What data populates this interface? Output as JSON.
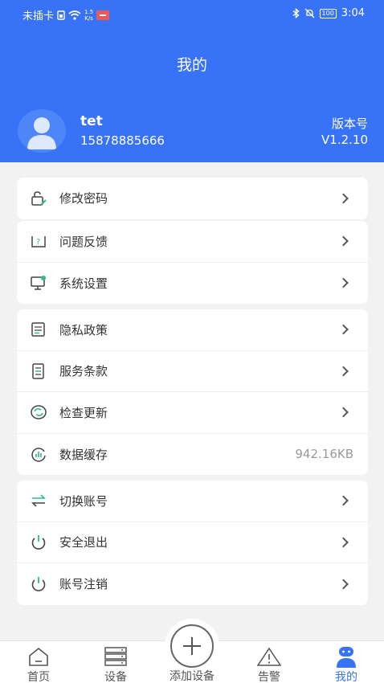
{
  "status_bar": {
    "carrier": "未插卡",
    "speed_value": "1.5",
    "speed_unit": "K/s",
    "battery": "100",
    "time": "3:04"
  },
  "header": {
    "title": "我的"
  },
  "profile": {
    "username": "tet",
    "phone": "15878885666",
    "version_label": "版本号",
    "version_value": "V1.2.10"
  },
  "menu_groups": [
    [
      {
        "label": "修改密码",
        "icon": "lock-edit-icon"
      }
    ],
    [
      {
        "label": "问题反馈",
        "icon": "feedback-icon"
      },
      {
        "label": "系统设置",
        "icon": "monitor-settings-icon"
      }
    ],
    [
      {
        "label": "隐私政策",
        "icon": "privacy-doc-icon"
      },
      {
        "label": "服务条款",
        "icon": "terms-doc-icon"
      },
      {
        "label": "检查更新",
        "icon": "refresh-icon"
      },
      {
        "label": "数据缓存",
        "icon": "cache-icon",
        "value": "942.16KB"
      }
    ],
    [
      {
        "label": "切换账号",
        "icon": "switch-account-icon"
      },
      {
        "label": "安全退出",
        "icon": "power-icon"
      },
      {
        "label": "账号注销",
        "icon": "power-icon"
      }
    ]
  ],
  "tabbar": {
    "home": "首页",
    "devices": "设备",
    "add_device": "添加设备",
    "alarms": "告警",
    "mine": "我的"
  },
  "colors": {
    "brand": "#3872f6",
    "icon_green": "#2dbb8f"
  }
}
